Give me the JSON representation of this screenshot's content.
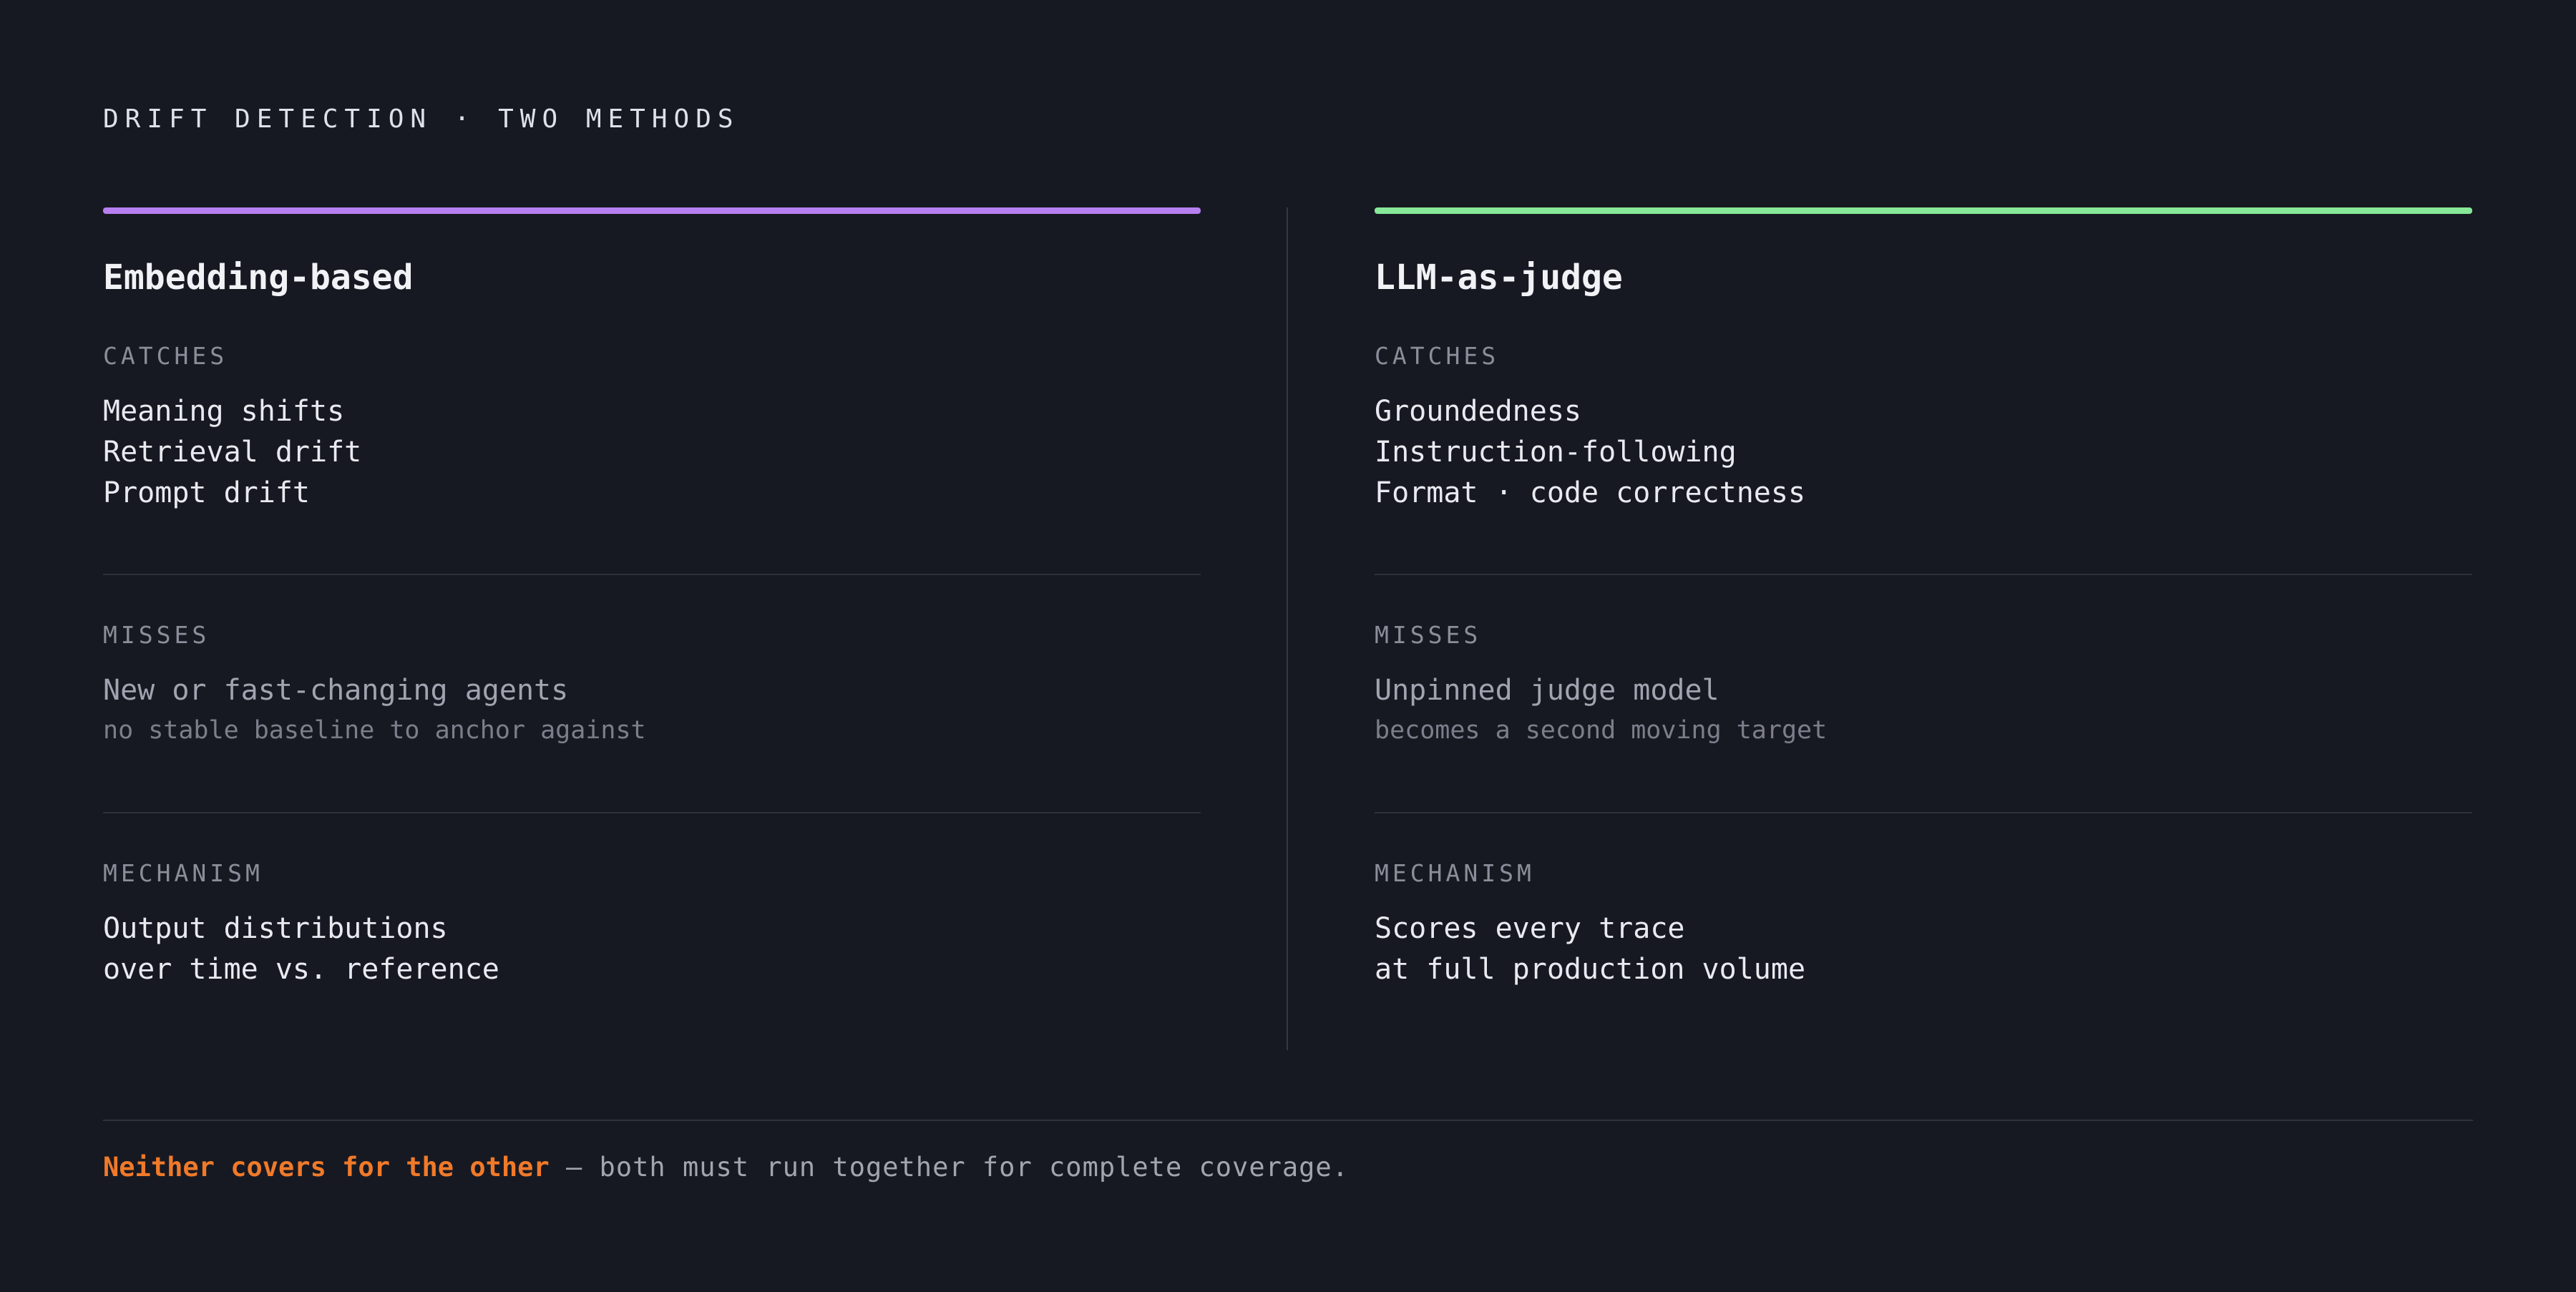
{
  "header": {
    "title": "DRIFT DETECTION · TWO METHODS"
  },
  "columns": [
    {
      "title": "Embedding-based",
      "accent_color": "#b77ff0",
      "catches_label": "CATCHES",
      "catches": [
        "Meaning shifts",
        "Retrieval drift",
        "Prompt drift"
      ],
      "misses_label": "MISSES",
      "misses_main": "New or fast-changing agents",
      "misses_sub": "no stable baseline to anchor against",
      "mechanism_label": "MECHANISM",
      "mechanism": [
        "Output distributions",
        "over time vs. reference"
      ]
    },
    {
      "title": "LLM-as-judge",
      "accent_color": "#86e898",
      "catches_label": "CATCHES",
      "catches": [
        "Groundedness",
        "Instruction-following",
        "Format · code correctness"
      ],
      "misses_label": "MISSES",
      "misses_main": "Unpinned judge model",
      "misses_sub": "becomes a second moving target",
      "mechanism_label": "MECHANISM",
      "mechanism": [
        "Scores every trace",
        "at full production volume"
      ]
    }
  ],
  "footer": {
    "emphasis": "Neither covers for the other",
    "rest": " — both must run together for complete coverage.",
    "emphasis_color": "#f07a2a"
  }
}
